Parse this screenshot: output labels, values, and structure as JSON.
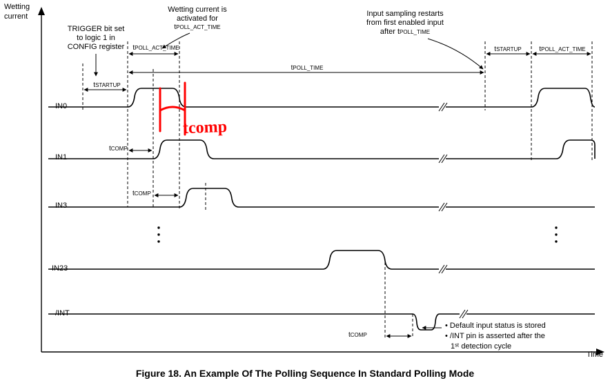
{
  "axes": {
    "y_label_line1": "Wetting",
    "y_label_line2": "current",
    "x_label": "Time"
  },
  "annotations": {
    "trigger_line1": "TRIGGER bit set",
    "trigger_line2": "to logic 1 in",
    "trigger_line3": "CONFIG register",
    "wetting_line1": "Wetting current is",
    "wetting_line2": "activated for",
    "sampling_line1": "Input sampling restarts",
    "sampling_line2": "from first enabled input",
    "sampling_line3_prefix": "after t",
    "sampling_line3_sub": "POLL_TIME"
  },
  "timing": {
    "t_poll_act_time_prefix": "t",
    "t_poll_act_time_sub": "POLL_ACT_TIME",
    "t_startup_prefix": "t",
    "t_startup_sub": "STARTUP",
    "t_poll_time_prefix": "t",
    "t_poll_time_sub": "POLL_TIME",
    "t_comp_prefix": "t",
    "t_comp_sub": "COMP"
  },
  "signals": {
    "in0": "IN0",
    "in1": "IN1",
    "in3": "IN3",
    "in23": "IN23",
    "int": "/INT"
  },
  "handwritten": {
    "text": "tcomp"
  },
  "int_notes": {
    "line1": "Default input status is stored",
    "line2_prefix": "/INT pin is asserted after the",
    "line2_suffix": "1ˢᵗ detection cycle"
  },
  "caption": "Figure 18.  An Example Of The Polling Sequence In Standard Polling Mode",
  "chart_data": {
    "type": "timing-diagram",
    "title": "An Example Of The Polling Sequence In Standard Polling Mode",
    "xlabel": "Time",
    "ylabel": "Wetting current",
    "signals": [
      "IN0",
      "IN1",
      "IN3",
      "IN23",
      "/INT"
    ],
    "time_markers": [
      "tSTARTUP",
      "tPOLL_ACT_TIME",
      "tPOLL_TIME",
      "tCOMP"
    ],
    "events": [
      {
        "signal": "IN0",
        "description": "TRIGGER bit set to logic 1 in CONFIG register initiates tSTARTUP, then IN0 wetting current pulse for tPOLL_ACT_TIME"
      },
      {
        "signal": "IN1",
        "description": "Wetting current pulse delayed by tCOMP relative to IN0"
      },
      {
        "signal": "IN3",
        "description": "Wetting current pulse delayed by tCOMP relative to IN1"
      },
      {
        "signal": "IN23",
        "description": "Last enabled input wetting current pulse in first cycle"
      },
      {
        "signal": "/INT",
        "description": "Asserted low briefly after first detection cycle; default input status stored"
      },
      {
        "description": "After tPOLL_TIME, sequence restarts from first enabled input with tSTARTUP then tPOLL_ACT_TIME"
      }
    ]
  }
}
